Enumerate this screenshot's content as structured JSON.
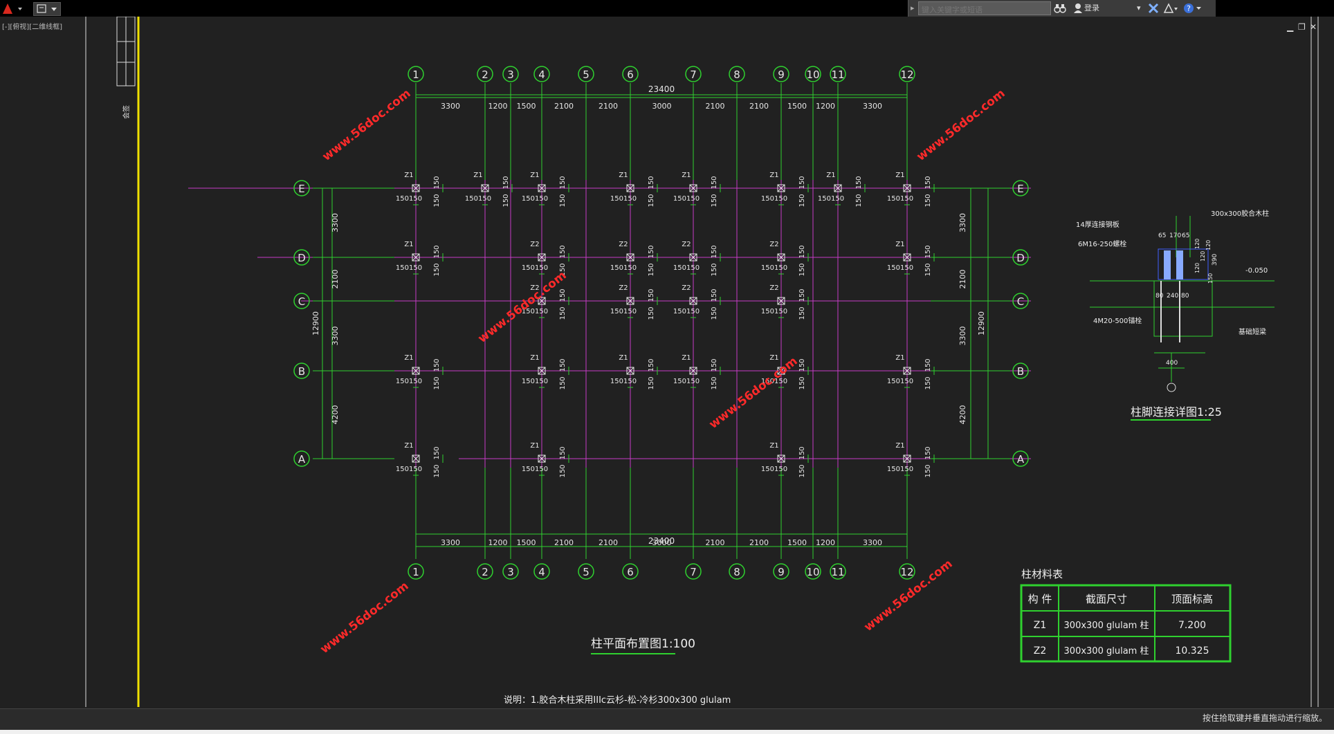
{
  "app": {
    "viewport_label": "[-][俯视][二维线框]",
    "search_placeholder": "键入关键字或短语",
    "login_label": "登录",
    "status_message": "按住拾取键并垂直拖动进行缩放。"
  },
  "icons": {
    "logo": "autocad-a-icon",
    "qat": "quick-access-icon",
    "binoculars": "binoculars-icon",
    "user": "user-icon",
    "exchange": "x-exchange-icon",
    "a360": "a360-icon",
    "help": "help-icon"
  },
  "colors": {
    "background": "#212121",
    "grid_green": "#2fd12f",
    "beam_magenta": "#c83cc8",
    "text": "#e6e6e6",
    "border_yellow": "#f0e000",
    "watermark": "#ff2a2a"
  },
  "drawing": {
    "grid_numbers": [
      "1",
      "2",
      "3",
      "4",
      "5",
      "6",
      "7",
      "8",
      "9",
      "10",
      "11",
      "12"
    ],
    "grid_letters": [
      "E",
      "D",
      "C",
      "B",
      "A"
    ],
    "total_width": "23400",
    "spans_x": [
      "3300",
      "1200",
      "1500",
      "2100",
      "2100",
      "3000",
      "2100",
      "2100",
      "1500",
      "1200",
      "3300"
    ],
    "spans_y": [
      "3300",
      "2100",
      "3300",
      "4200"
    ],
    "total_height": "12900",
    "column_labels": [
      "Z1",
      "Z2"
    ],
    "dim_150": "150",
    "plan_title": "柱平面布置图1:100",
    "note": "说明：1.胶合木柱采用IIIc云杉-松-冷杉300x300 glulam",
    "watermark": "www.56doc.com",
    "side_text": "会签"
  },
  "detail": {
    "title": "柱脚连接详图1:25",
    "labels": [
      "300x300胶合木柱",
      "14厚连接钢板",
      "6M16-250螺栓",
      "4M20-500锚栓",
      "基础短梁",
      "-0.050"
    ],
    "dims": [
      "65",
      "170",
      "65",
      "80",
      "240",
      "80",
      "400",
      "390",
      "120",
      "120",
      "120",
      "120",
      "150"
    ]
  },
  "table": {
    "caption": "柱材料表",
    "headers": [
      "构 件",
      "截面尺寸",
      "顶面标高"
    ],
    "rows": [
      [
        "Z1",
        "300x300 glulam 柱",
        "7.200"
      ],
      [
        "Z2",
        "300x300 glulam 柱",
        "10.325"
      ]
    ]
  }
}
